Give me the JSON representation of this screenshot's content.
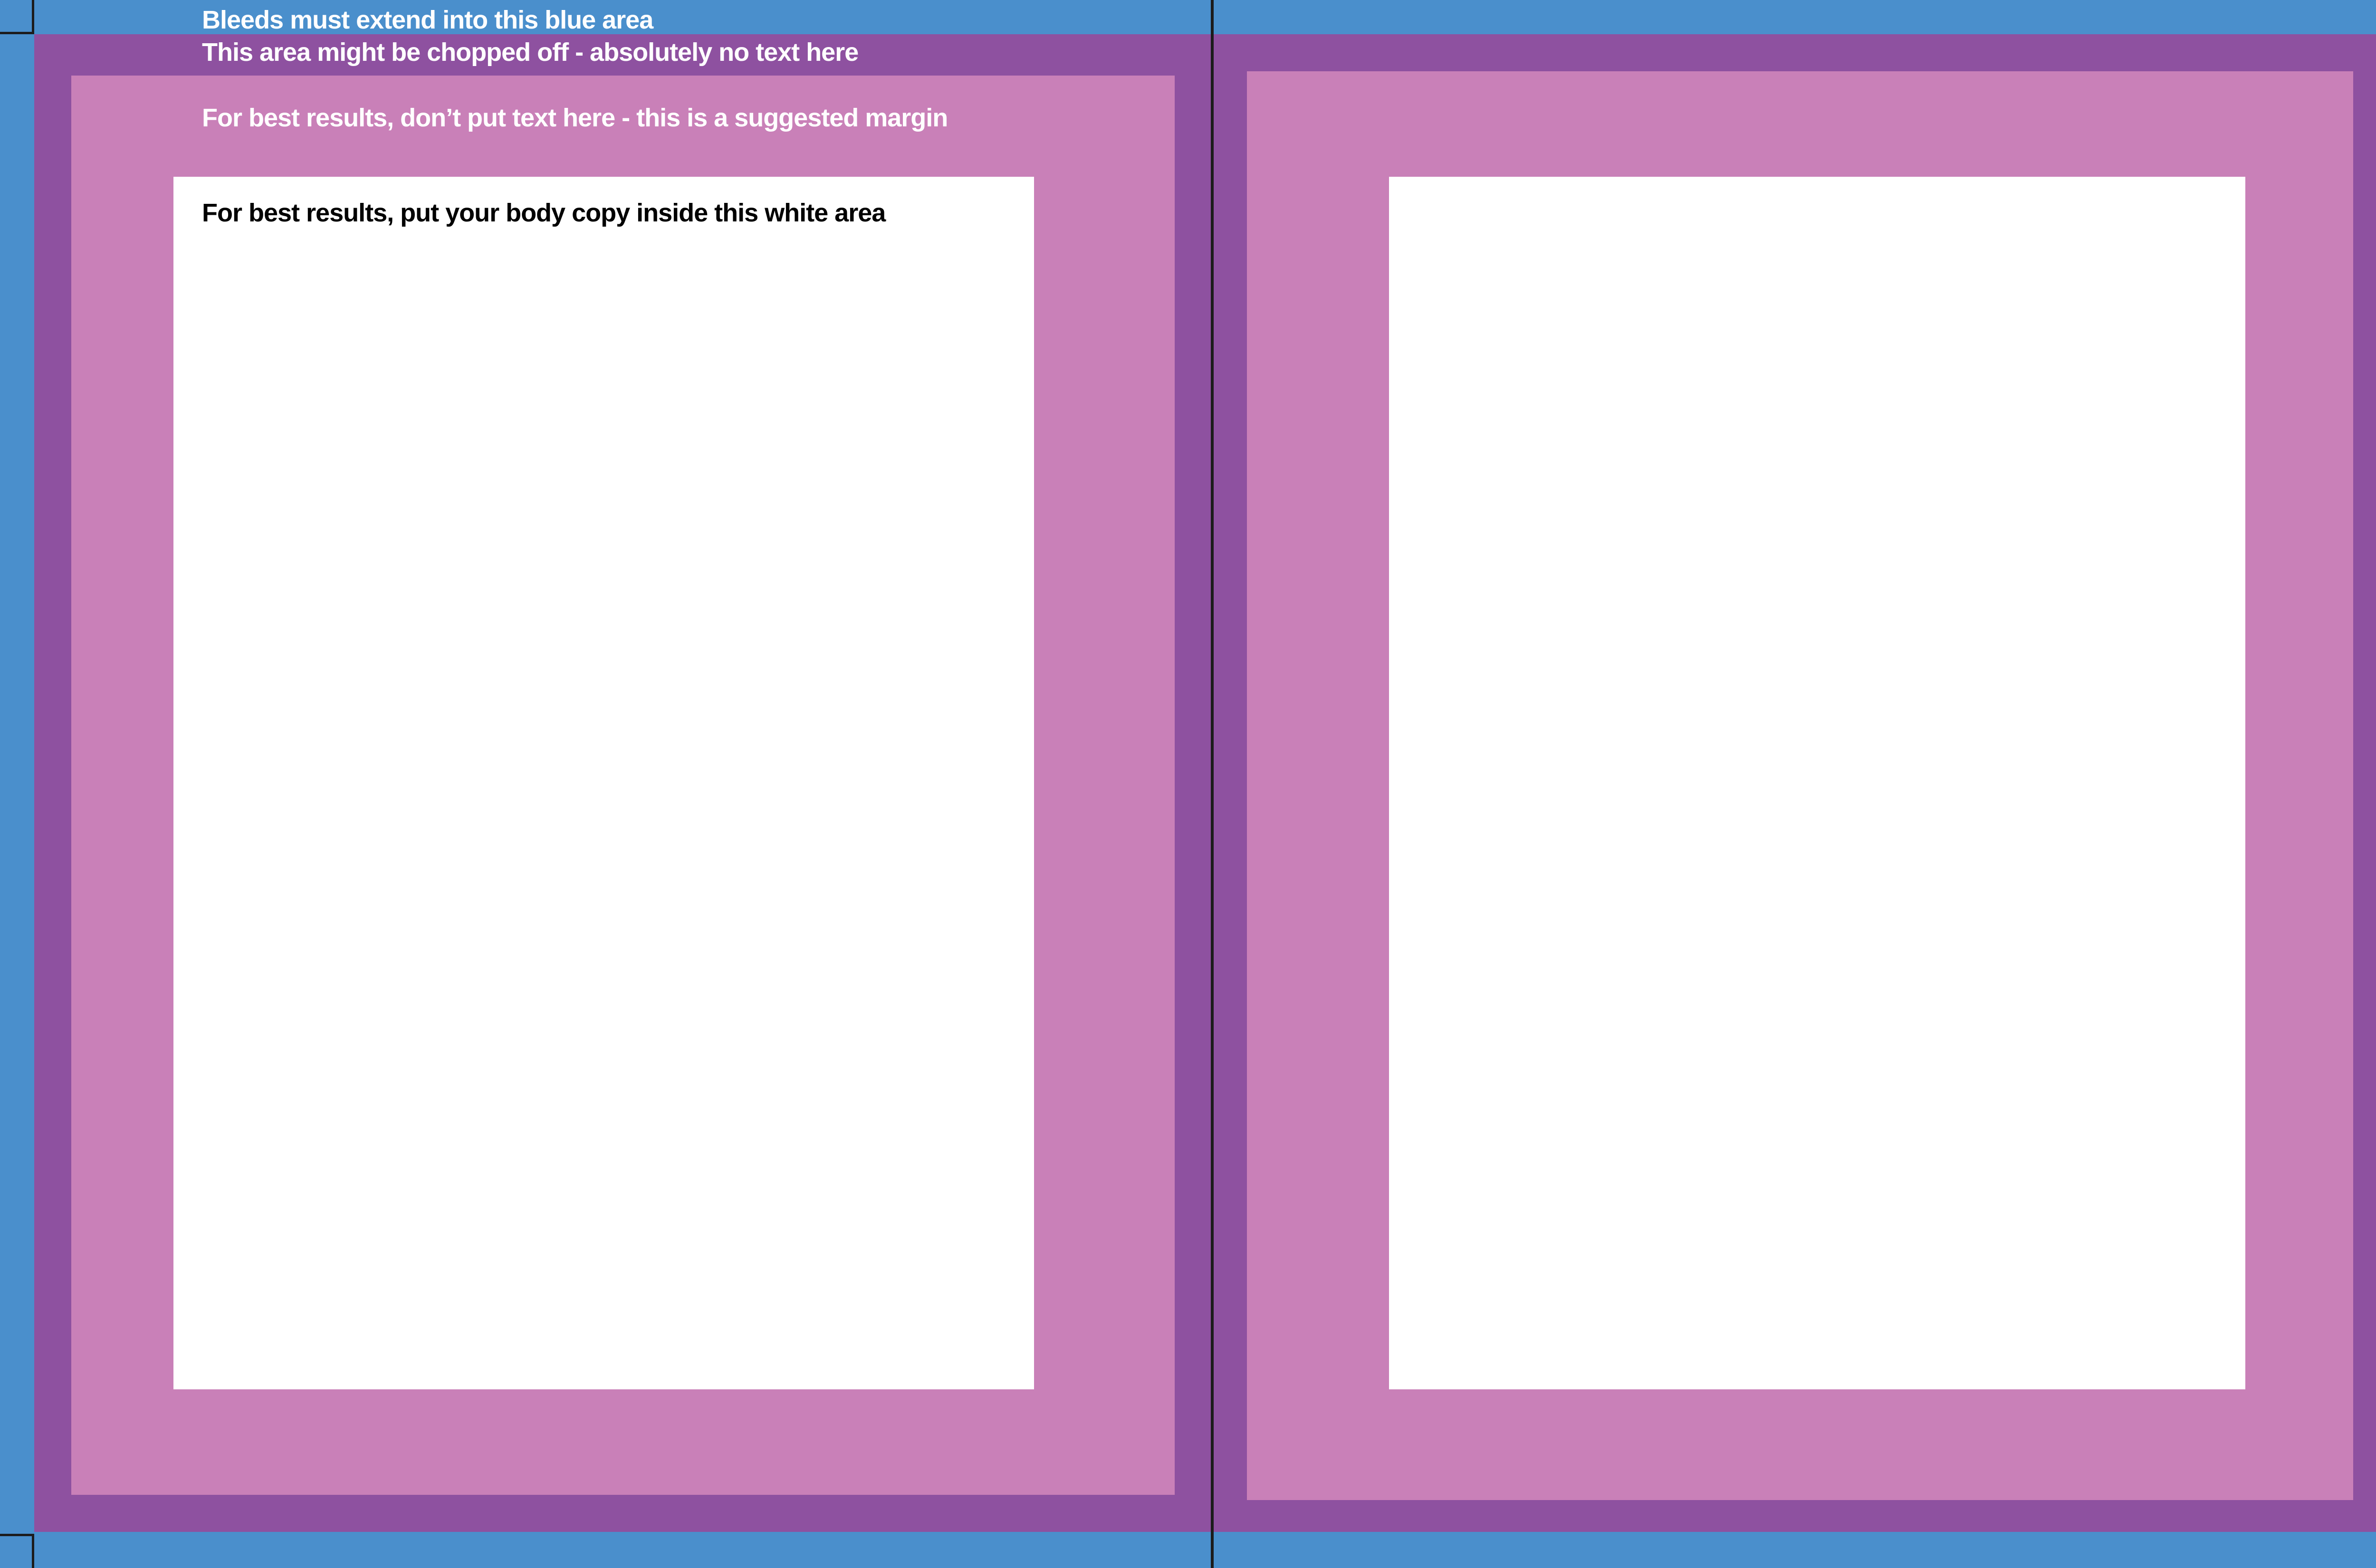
{
  "spread": {
    "notes": {
      "bleed": "Bleeds must extend into this blue area",
      "trim": "This area might be chopped off - absolutely no text here",
      "margin": "For best results, don’t put text here - this is a suggested margin",
      "body": "For best results, put your body copy inside this white area"
    }
  },
  "colors": {
    "bleed": "#4a8fcc",
    "trim": "#8e51a0",
    "margin": "#c980b8",
    "body": "#ffffff",
    "spine": "#1c1c1c"
  }
}
